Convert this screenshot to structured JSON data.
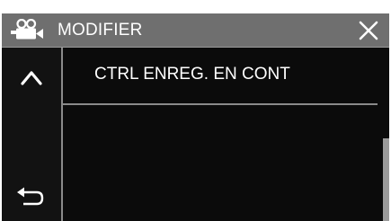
{
  "header": {
    "title": "MODIFIER",
    "mode_icon": "video-camera-icon",
    "close_icon": "close-icon"
  },
  "navigation": {
    "up_icon": "chevron-up-icon",
    "back_icon": "return-arrow-icon"
  },
  "menu": {
    "items": [
      {
        "label": "CTRL ENREG. EN CONT"
      }
    ]
  },
  "colors": {
    "header_bg": "#6f6f6f",
    "screen_bg": "#0b0b0b",
    "text": "#ffffff",
    "divider": "#8a8a8a"
  }
}
